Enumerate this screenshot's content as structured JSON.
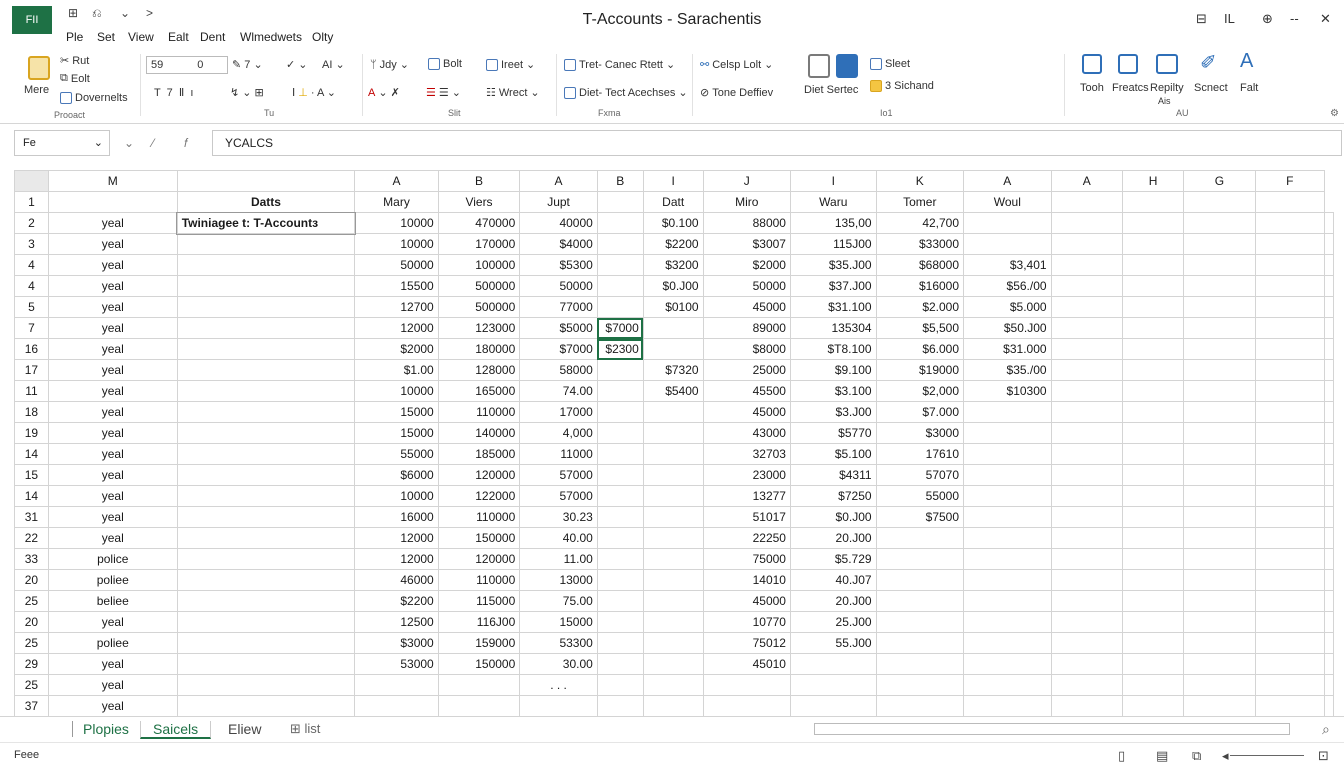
{
  "title_bar": {
    "app_badge": "FII",
    "title": "T-Accounts - Sarachentis",
    "quick_access": [
      "⊞",
      "⎌",
      "⌄",
      ">"
    ],
    "right_icons": [
      "⊟",
      "IL",
      "⊕",
      "--",
      "✕"
    ]
  },
  "menu": [
    "Ple",
    "Set",
    "View",
    "Ealt",
    "Dent",
    "Wlmedwets",
    "Olty"
  ],
  "ribbon": {
    "clipboard": {
      "paste_label": "Mere",
      "cut": "Rut",
      "copy": "Eolt",
      "format": "Dovernelts",
      "group": "Prooact"
    },
    "font": {
      "font_box": "59",
      "size_box": "0",
      "group": "Tu"
    },
    "alignment": {
      "jdy": "Jdy",
      "bolt": "Bolt",
      "wrect": "Wrect",
      "group": "Slit"
    },
    "insert": {
      "insert": "Ireet",
      "tret": "Tret- Canec Rtett",
      "diet": "Diet- Tect Acechses",
      "group": "Fxma"
    },
    "editing": {
      "celsp": "Celsp Lolt",
      "tone": "Tone Deffiev",
      "diet_sertec": "Diet Sertec",
      "group": ""
    },
    "styles": {
      "sleet": "Sleet",
      "sichand": "3 Sichand",
      "group": "Io1"
    },
    "analysis": {
      "tools": [
        "Tooh",
        "Freatcs",
        "Repilty",
        "Scnect",
        "Falt"
      ],
      "sub": "Ais",
      "group": "AU"
    }
  },
  "formula_bar": {
    "name_box": "Fe",
    "content": "YCALCS"
  },
  "grid": {
    "col_letters": [
      "M",
      "",
      "A",
      "B",
      "A",
      "B",
      "I",
      "J",
      "I",
      "K",
      "A",
      "A",
      "H",
      "G",
      "F"
    ],
    "header_row": {
      "row_num": "1",
      "cells": [
        "",
        "Datts",
        "Mary",
        "Viers",
        "Jupt",
        "",
        "Datt",
        "Miro",
        "Waru",
        "Tomer",
        "Woul",
        "",
        "",
        "",
        ""
      ]
    },
    "rows": [
      {
        "r": "2",
        "c": [
          "yeal",
          "Twiniagee t: T-Accountɜ",
          "10000",
          "470000",
          "40000",
          "",
          "$0.100",
          "88000",
          "135,00",
          "42,700",
          "",
          "",
          "",
          "",
          ""
        ]
      },
      {
        "r": "3",
        "c": [
          "yeal",
          "",
          "10000",
          "170000",
          "$4000",
          "",
          "$2200",
          "$3007",
          "115J00",
          "$33000",
          "",
          "",
          "",
          "",
          ""
        ]
      },
      {
        "r": "4",
        "c": [
          "yeal",
          "",
          "50000",
          "100000",
          "$5300",
          "",
          "$3200",
          "$2000",
          "$35.J00",
          "$68000",
          "$3,401",
          "",
          "",
          "",
          ""
        ]
      },
      {
        "r": "4",
        "c": [
          "yeal",
          "",
          "15500",
          "500000",
          "50000",
          "",
          "$0.J00",
          "50000",
          "$37.J00",
          "$16000",
          "$56./00",
          "",
          "",
          "",
          ""
        ]
      },
      {
        "r": "5",
        "c": [
          "yeal",
          "",
          "12700",
          "500000",
          "77000",
          "",
          "$0100",
          "45000",
          "$31.100",
          "$2.000",
          "$5.000",
          "",
          "",
          "",
          ""
        ]
      },
      {
        "r": "7",
        "c": [
          "yeal",
          "",
          "12000",
          "123000",
          "$5000",
          "$7000",
          "",
          "89000",
          "135304",
          "$5,500",
          "$50.J00",
          "",
          "",
          "",
          ""
        ]
      },
      {
        "r": "16",
        "c": [
          "yeal",
          "",
          "$2000",
          "180000",
          "$7000",
          "$2300",
          "",
          "$8000",
          "$T8.100",
          "$6.000",
          "$31.000",
          "",
          "",
          "",
          ""
        ]
      },
      {
        "r": "17",
        "c": [
          "yeal",
          "",
          "$1.00",
          "128000",
          "58000",
          "",
          "$7320",
          "25000",
          "$9.100",
          "$19000",
          "$35./00",
          "",
          "",
          "",
          ""
        ]
      },
      {
        "r": "11",
        "c": [
          "yeal",
          "",
          "10000",
          "165000",
          "74.00",
          "",
          "$5400",
          "45500",
          "$3.100",
          "$2,000",
          "$10300",
          "",
          "",
          "",
          ""
        ]
      },
      {
        "r": "18",
        "c": [
          "yeal",
          "",
          "15000",
          "110000",
          "17000",
          "",
          "",
          "45000",
          "$3.J00",
          "$7.000",
          "",
          "",
          "",
          "",
          ""
        ]
      },
      {
        "r": "19",
        "c": [
          "yeal",
          "",
          "15000",
          "140000",
          "4,000",
          "",
          "",
          "43000",
          "$5770",
          "$3000",
          "",
          "",
          "",
          "",
          ""
        ]
      },
      {
        "r": "14",
        "c": [
          "yeal",
          "",
          "55000",
          "185000",
          "11000",
          "",
          "",
          "32703",
          "$5.100",
          "17610",
          "",
          "",
          "",
          "",
          ""
        ]
      },
      {
        "r": "15",
        "c": [
          "yeal",
          "",
          "$6000",
          "120000",
          "57000",
          "",
          "",
          "23000",
          "$4311",
          "57070",
          "",
          "",
          "",
          "",
          ""
        ]
      },
      {
        "r": "14",
        "c": [
          "yeal",
          "",
          "10000",
          "122000",
          "57000",
          "",
          "",
          "13277",
          "$7250",
          "55000",
          "",
          "",
          "",
          "",
          ""
        ]
      },
      {
        "r": "31",
        "c": [
          "yeal",
          "",
          "16000",
          "110000",
          "30.23",
          "",
          "",
          "51017",
          "$0.J00",
          "$7500",
          "",
          "",
          "",
          "",
          ""
        ]
      },
      {
        "r": "22",
        "c": [
          "yeal",
          "",
          "12000",
          "150000",
          "40.00",
          "",
          "",
          "22250",
          "20.J00",
          "",
          "",
          "",
          "",
          "",
          ""
        ]
      },
      {
        "r": "33",
        "c": [
          "police",
          "",
          "12000",
          "120000",
          "11.00",
          "",
          "",
          "75000",
          "$5.729",
          "",
          "",
          "",
          "",
          "",
          ""
        ]
      },
      {
        "r": "20",
        "c": [
          "poliee",
          "",
          "46000",
          "110000",
          "13000",
          "",
          "",
          "14010",
          "40.J07",
          "",
          "",
          "",
          "",
          "",
          ""
        ]
      },
      {
        "r": "25",
        "c": [
          "beliee",
          "",
          "$2200",
          "115000",
          "75.00",
          "",
          "",
          "45000",
          "20.J00",
          "",
          "",
          "",
          "",
          "",
          ""
        ]
      },
      {
        "r": "20",
        "c": [
          "yeal",
          "",
          "12500",
          "116J00",
          "15000",
          "",
          "",
          "10770",
          "25.J00",
          "",
          "",
          "",
          "",
          "",
          ""
        ]
      },
      {
        "r": "25",
        "c": [
          "poliee",
          "",
          "$3000",
          "159000",
          "53300",
          "",
          "",
          "75012",
          "55.J00",
          "",
          "",
          "",
          "",
          "",
          ""
        ]
      },
      {
        "r": "29",
        "c": [
          "yeal",
          "",
          "53000",
          "150000",
          "30.00",
          "",
          "",
          "45010",
          "",
          "",
          "",
          "",
          "",
          "",
          ""
        ]
      },
      {
        "r": "25",
        "c": [
          "yeal",
          "",
          "",
          "",
          ". . .",
          "",
          "",
          "",
          "",
          "",
          "",
          "",
          "",
          "",
          ""
        ]
      },
      {
        "r": "37",
        "c": [
          "yeal",
          "",
          "",
          "",
          "",
          "",
          "",
          "",
          "",
          "",
          "",
          "",
          "",
          "",
          ""
        ]
      }
    ]
  },
  "sheet_tabs": [
    "Plopies",
    "Saicels",
    "Eliew",
    "list"
  ],
  "status": {
    "text": "Feee"
  },
  "colors": {
    "accent": "#1e7145",
    "gridline": "#d4d4d4"
  }
}
